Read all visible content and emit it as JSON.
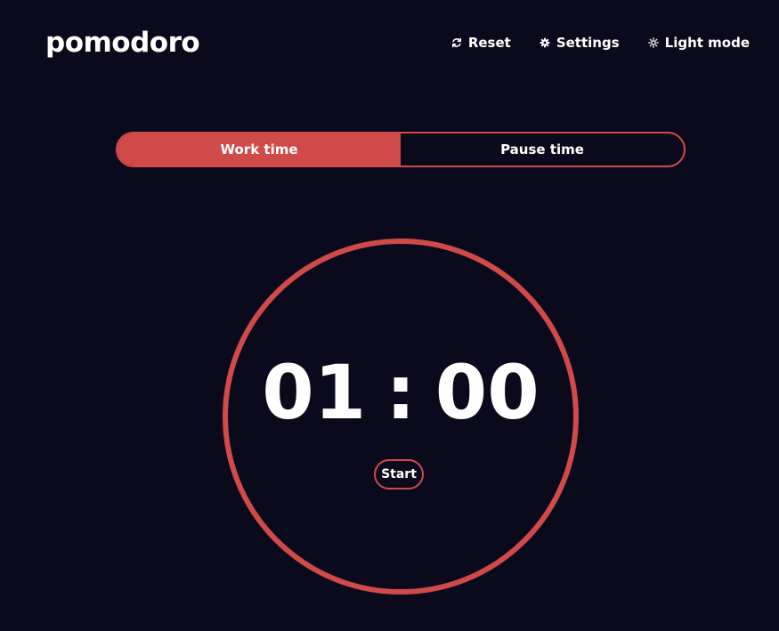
{
  "app": {
    "logo": "pomodoro"
  },
  "nav": {
    "reset": {
      "label": "Reset",
      "icon": "refresh-icon"
    },
    "settings": {
      "label": "Settings",
      "icon": "gear-icon"
    },
    "theme": {
      "label": "Light mode",
      "icon": "sun-icon"
    }
  },
  "modes": {
    "work_label": "Work time",
    "pause_label": "Pause time",
    "active": "work"
  },
  "timer": {
    "minutes": "01",
    "separator": ":",
    "seconds": "00",
    "start_label": "Start"
  },
  "colors": {
    "background": "#0a0a1c",
    "accent": "#d14a4a",
    "text": "#ffffff"
  }
}
